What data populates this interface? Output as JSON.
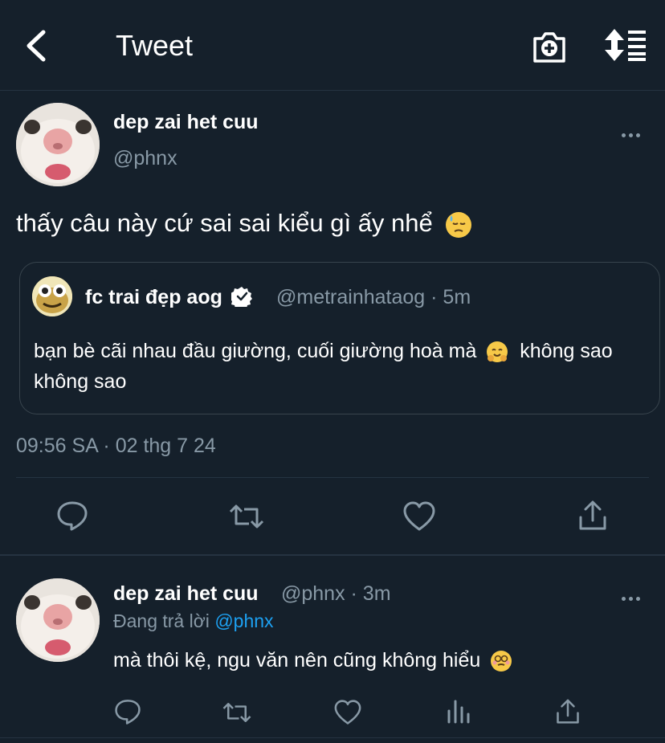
{
  "header": {
    "title": "Tweet"
  },
  "tweet": {
    "author_name": "dep zai het cuu",
    "author_handle": "@phnx",
    "text": "thấy câu này cứ sai sai kiểu gì ấy nhể",
    "text_emoji": "downcast-face-with-sweat-emoji",
    "timestamp": "09:56 SA · 02 thg 7 24"
  },
  "quote": {
    "author_name": "fc trai đẹp aog",
    "verified": true,
    "meta": "@metrainhataog · 5m",
    "text_part1": "bạn bè cãi nhau đầu giường, cuối giường hoà mà",
    "text_emoji": "hugging-face-emoji",
    "text_part2": "không sao không sao"
  },
  "reply": {
    "author_name": "dep zai het cuu",
    "meta": "@phnx · 3m",
    "replying_prefix": "Đang trả lời",
    "replying_to": "@phnx",
    "text": "mà thôi kệ, ngu văn nên cũng không hiểu",
    "text_emoji": "dizzy-face-emoji"
  },
  "colors": {
    "background": "#15202b",
    "muted": "#8899a6",
    "link": "#1da1f2",
    "divider": "#253341"
  }
}
